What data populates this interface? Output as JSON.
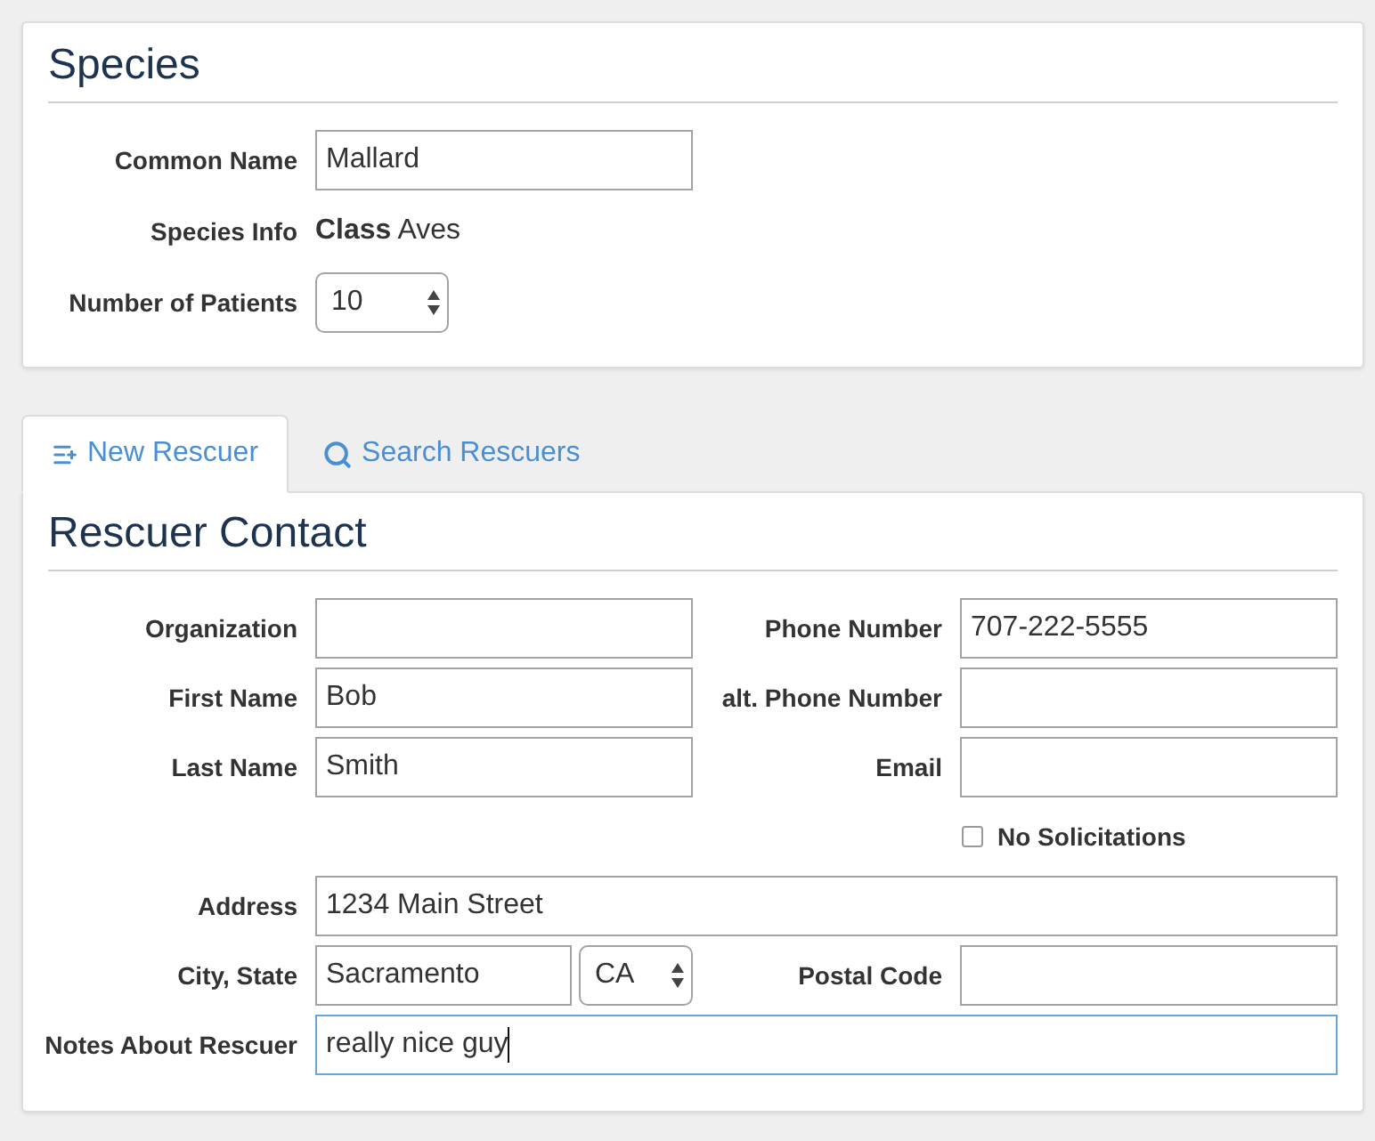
{
  "species": {
    "title": "Species",
    "fields": [
      {
        "kind": "text",
        "label": "Common Name",
        "value": "Mallard"
      },
      {
        "kind": "info",
        "label": "Species Info",
        "value": "**Class** Aves"
      },
      {
        "kind": "select",
        "label": "Number of Patients",
        "value": "10"
      }
    ]
  },
  "tabs": [
    {
      "label": "New Rescuer",
      "selected": true
    },
    {
      "label": "Search Rescuers",
      "selected": false
    }
  ],
  "rescuer": {
    "title": "Rescuer Contact",
    "contact_rows": [
      {
        "left": {
          "label": "Organization"
        },
        "right": {
          "label": "Phone Number",
          "value": "707-222-5555"
        }
      },
      {
        "left": {
          "label": "First Name",
          "value": "Bob"
        },
        "right": {
          "label": "alt. Phone Number"
        }
      },
      {
        "left": {
          "label": "Last Name",
          "value": "Smith"
        },
        "right": {
          "label": "Email"
        }
      }
    ],
    "no_solicitations": {
      "label": "No Solicitations",
      "checked": false
    },
    "address": {
      "label": "Address",
      "value": "1234 Main Street"
    },
    "city_state": {
      "label": "City, State",
      "city": "Sacramento",
      "state": "CA"
    },
    "postal_code": {
      "label": "Postal Code"
    },
    "notes": {
      "label": "Notes About Rescuer",
      "value": "really nice guy",
      "focused": true
    }
  }
}
